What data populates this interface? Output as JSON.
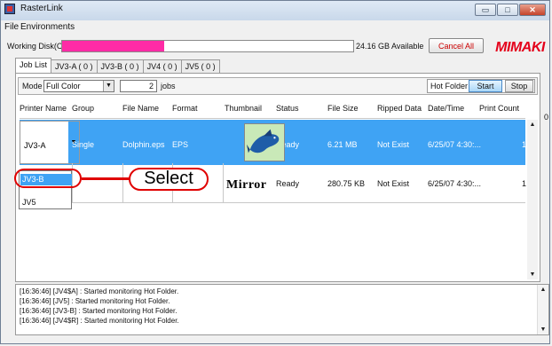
{
  "window": {
    "title": "RasterLink",
    "btn_min": "▭",
    "btn_max": "□",
    "btn_close": "✕"
  },
  "menu": [
    {
      "label": "File"
    },
    {
      "label": "Environments"
    }
  ],
  "disk": {
    "label": "Working Disk(C:)",
    "percent_text": "35%",
    "fill_fraction": 0.35,
    "fill_color": "#ff2ba6",
    "available": "24.16 GB Available",
    "cancel_label": "Cancel All"
  },
  "logo": {
    "text": "MIMAKI",
    "color": "#e4001b"
  },
  "tabs": [
    {
      "label": "Job List"
    },
    {
      "label": "JV3-A ( 0 )"
    },
    {
      "label": "JV3-B ( 0 )"
    },
    {
      "label": "JV4 ( 0 )"
    },
    {
      "label": "JV5 ( 0 )"
    }
  ],
  "toolbar": {
    "mode_label": "Mode",
    "mode_value": "Full Color",
    "jobs_count": "2",
    "jobs_label": "jobs",
    "hot_folder_label": "Hot Folder",
    "start_label": "Start",
    "stop_label": "Stop"
  },
  "table": {
    "headers": [
      "Printer Name",
      "Group",
      "File Name",
      "Format",
      "Thumbnail",
      "Status",
      "File Size",
      "Ripped Data",
      "Date/Time",
      "Print Count"
    ],
    "rows": [
      {
        "printer": "JV3-A",
        "group": "Single",
        "file_name": "Dolphin.eps",
        "format": "EPS",
        "status": "Ready",
        "file_size": "6.21 MB",
        "ripped": "Not Exist",
        "datetime": "6/25/07 4:30:...",
        "count": "1"
      },
      {
        "printer": "",
        "group": "",
        "file_name": "",
        "format": "",
        "thumbnail_text": "Mirror",
        "status": "Ready",
        "file_size": "280.75 KB",
        "ripped": "Not Exist",
        "datetime": "6/25/07 4:30:...",
        "count": "1"
      }
    ],
    "selected_color": "#3fa3f4"
  },
  "dropdown_options": [
    {
      "label": "JV3-B",
      "selected": true
    },
    {
      "label": ""
    },
    {
      "label": "JV5"
    }
  ],
  "callout": {
    "label": "Select",
    "color": "#e00000"
  },
  "side_text": "0",
  "log": [
    "[16:36:46] [JV4$A] : Started monitoring Hot Folder.",
    "[16:36:46] [JV5] : Started monitoring Hot Folder.",
    "[16:36:46] [JV3-B] : Started monitoring Hot Folder.",
    "[16:36:46] [JV4$R] : Started monitoring Hot Folder."
  ]
}
